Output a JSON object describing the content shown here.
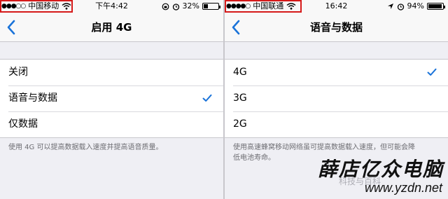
{
  "accent_color": "#1a73d9",
  "highlight_color": "#d61a1a",
  "left_screen": {
    "status_bar": {
      "signal": "●●●○○",
      "carrier": "中国移动",
      "time": "下午4:42",
      "battery_text": "32%",
      "battery_level": 0.32,
      "icons": [
        "wifi-icon",
        "lock-rotation-icon",
        "alarm-icon",
        "battery-icon"
      ]
    },
    "nav": {
      "title": "启用 4G",
      "back_icon": "chevron-left-icon"
    },
    "options": [
      {
        "label": "关闭",
        "checked": false
      },
      {
        "label": "语音与数据",
        "checked": true
      },
      {
        "label": "仅数据",
        "checked": false
      }
    ],
    "footnote": "使用 4G 可以提高数据载入速度并提高语音质量。"
  },
  "right_screen": {
    "status_bar": {
      "signal": "●●●●○",
      "carrier": "中国联通",
      "time": "16:42",
      "battery_text": "94%",
      "battery_level": 0.94,
      "icons": [
        "wifi-icon",
        "location-icon",
        "alarm-icon",
        "battery-icon"
      ]
    },
    "nav": {
      "title": "语音与数据",
      "back_icon": "chevron-left-icon"
    },
    "options": [
      {
        "label": "4G",
        "checked": true
      },
      {
        "label": "3G",
        "checked": false
      },
      {
        "label": "2G",
        "checked": false
      }
    ],
    "footnote_line1": "使用高速蜂窝移动网络虽可提高数据载入速度，但可能会降",
    "footnote_line2": "低电池寿命。"
  },
  "watermark": {
    "name": "薛店亿众电脑",
    "faint_text": "科技与百科",
    "url": "www.yzdn.net"
  }
}
